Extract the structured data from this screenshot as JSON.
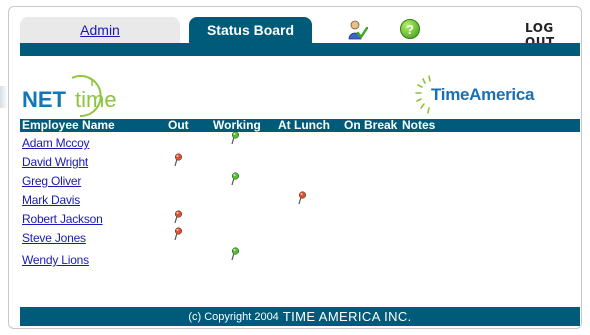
{
  "nav": {
    "tabs": [
      {
        "label": "Admin",
        "active": false
      },
      {
        "label": "Status Board",
        "active": true
      }
    ],
    "user_icon": "user-check-icon",
    "help_icon": "help-icon",
    "help_symbol": "?",
    "logout_label": "LOG OUT"
  },
  "logos": {
    "left": {
      "part1": "NET",
      "part2": "time"
    },
    "right": {
      "text": "TimeAmerica"
    }
  },
  "table": {
    "columns": [
      "Employee Name",
      "Out",
      "Working",
      "At Lunch",
      "On Break",
      "Notes"
    ],
    "rows": [
      {
        "name": "Adam Mccoy",
        "status": "Working"
      },
      {
        "name": "David Wright",
        "status": "Out"
      },
      {
        "name": "Greg Oliver",
        "status": "Working"
      },
      {
        "name": "Mark Davis",
        "status": "At Lunch"
      },
      {
        "name": "Robert Jackson",
        "status": "Out"
      },
      {
        "name": "Steve Jones",
        "status": "Out"
      },
      {
        "name": "Wendy Lions",
        "status": "Working"
      }
    ]
  },
  "colors": {
    "bar": "#005a7a",
    "link": "#1a1ab5",
    "pin_green": "#4fc130",
    "pin_red": "#e0502a"
  },
  "footer": {
    "copyright": "(c) Copyright 2004",
    "company": "TIME AMERICA INC."
  }
}
